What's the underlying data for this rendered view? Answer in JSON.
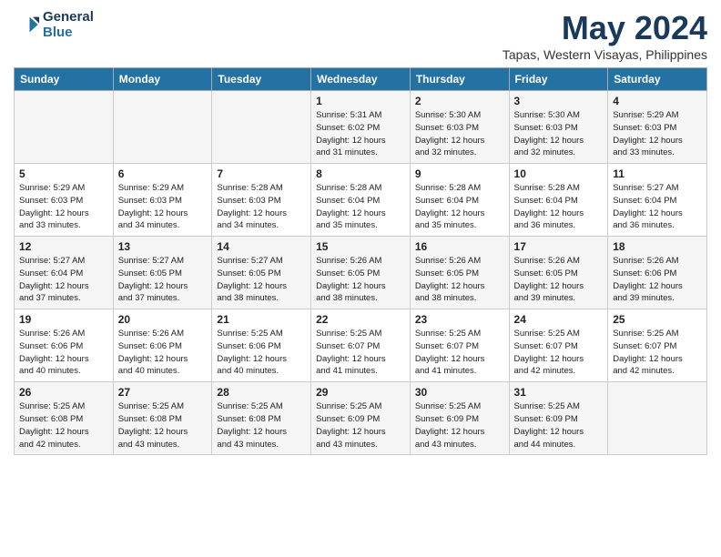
{
  "header": {
    "logo_line1": "General",
    "logo_line2": "Blue",
    "title": "May 2024",
    "location": "Tapas, Western Visayas, Philippines"
  },
  "weekdays": [
    "Sunday",
    "Monday",
    "Tuesday",
    "Wednesday",
    "Thursday",
    "Friday",
    "Saturday"
  ],
  "weeks": [
    [
      {
        "day": "",
        "info": ""
      },
      {
        "day": "",
        "info": ""
      },
      {
        "day": "",
        "info": ""
      },
      {
        "day": "1",
        "info": "Sunrise: 5:31 AM\nSunset: 6:02 PM\nDaylight: 12 hours\nand 31 minutes."
      },
      {
        "day": "2",
        "info": "Sunrise: 5:30 AM\nSunset: 6:03 PM\nDaylight: 12 hours\nand 32 minutes."
      },
      {
        "day": "3",
        "info": "Sunrise: 5:30 AM\nSunset: 6:03 PM\nDaylight: 12 hours\nand 32 minutes."
      },
      {
        "day": "4",
        "info": "Sunrise: 5:29 AM\nSunset: 6:03 PM\nDaylight: 12 hours\nand 33 minutes."
      }
    ],
    [
      {
        "day": "5",
        "info": "Sunrise: 5:29 AM\nSunset: 6:03 PM\nDaylight: 12 hours\nand 33 minutes."
      },
      {
        "day": "6",
        "info": "Sunrise: 5:29 AM\nSunset: 6:03 PM\nDaylight: 12 hours\nand 34 minutes."
      },
      {
        "day": "7",
        "info": "Sunrise: 5:28 AM\nSunset: 6:03 PM\nDaylight: 12 hours\nand 34 minutes."
      },
      {
        "day": "8",
        "info": "Sunrise: 5:28 AM\nSunset: 6:04 PM\nDaylight: 12 hours\nand 35 minutes."
      },
      {
        "day": "9",
        "info": "Sunrise: 5:28 AM\nSunset: 6:04 PM\nDaylight: 12 hours\nand 35 minutes."
      },
      {
        "day": "10",
        "info": "Sunrise: 5:28 AM\nSunset: 6:04 PM\nDaylight: 12 hours\nand 36 minutes."
      },
      {
        "day": "11",
        "info": "Sunrise: 5:27 AM\nSunset: 6:04 PM\nDaylight: 12 hours\nand 36 minutes."
      }
    ],
    [
      {
        "day": "12",
        "info": "Sunrise: 5:27 AM\nSunset: 6:04 PM\nDaylight: 12 hours\nand 37 minutes."
      },
      {
        "day": "13",
        "info": "Sunrise: 5:27 AM\nSunset: 6:05 PM\nDaylight: 12 hours\nand 37 minutes."
      },
      {
        "day": "14",
        "info": "Sunrise: 5:27 AM\nSunset: 6:05 PM\nDaylight: 12 hours\nand 38 minutes."
      },
      {
        "day": "15",
        "info": "Sunrise: 5:26 AM\nSunset: 6:05 PM\nDaylight: 12 hours\nand 38 minutes."
      },
      {
        "day": "16",
        "info": "Sunrise: 5:26 AM\nSunset: 6:05 PM\nDaylight: 12 hours\nand 38 minutes."
      },
      {
        "day": "17",
        "info": "Sunrise: 5:26 AM\nSunset: 6:05 PM\nDaylight: 12 hours\nand 39 minutes."
      },
      {
        "day": "18",
        "info": "Sunrise: 5:26 AM\nSunset: 6:06 PM\nDaylight: 12 hours\nand 39 minutes."
      }
    ],
    [
      {
        "day": "19",
        "info": "Sunrise: 5:26 AM\nSunset: 6:06 PM\nDaylight: 12 hours\nand 40 minutes."
      },
      {
        "day": "20",
        "info": "Sunrise: 5:26 AM\nSunset: 6:06 PM\nDaylight: 12 hours\nand 40 minutes."
      },
      {
        "day": "21",
        "info": "Sunrise: 5:25 AM\nSunset: 6:06 PM\nDaylight: 12 hours\nand 40 minutes."
      },
      {
        "day": "22",
        "info": "Sunrise: 5:25 AM\nSunset: 6:07 PM\nDaylight: 12 hours\nand 41 minutes."
      },
      {
        "day": "23",
        "info": "Sunrise: 5:25 AM\nSunset: 6:07 PM\nDaylight: 12 hours\nand 41 minutes."
      },
      {
        "day": "24",
        "info": "Sunrise: 5:25 AM\nSunset: 6:07 PM\nDaylight: 12 hours\nand 42 minutes."
      },
      {
        "day": "25",
        "info": "Sunrise: 5:25 AM\nSunset: 6:07 PM\nDaylight: 12 hours\nand 42 minutes."
      }
    ],
    [
      {
        "day": "26",
        "info": "Sunrise: 5:25 AM\nSunset: 6:08 PM\nDaylight: 12 hours\nand 42 minutes."
      },
      {
        "day": "27",
        "info": "Sunrise: 5:25 AM\nSunset: 6:08 PM\nDaylight: 12 hours\nand 43 minutes."
      },
      {
        "day": "28",
        "info": "Sunrise: 5:25 AM\nSunset: 6:08 PM\nDaylight: 12 hours\nand 43 minutes."
      },
      {
        "day": "29",
        "info": "Sunrise: 5:25 AM\nSunset: 6:09 PM\nDaylight: 12 hours\nand 43 minutes."
      },
      {
        "day": "30",
        "info": "Sunrise: 5:25 AM\nSunset: 6:09 PM\nDaylight: 12 hours\nand 43 minutes."
      },
      {
        "day": "31",
        "info": "Sunrise: 5:25 AM\nSunset: 6:09 PM\nDaylight: 12 hours\nand 44 minutes."
      },
      {
        "day": "",
        "info": ""
      }
    ]
  ]
}
